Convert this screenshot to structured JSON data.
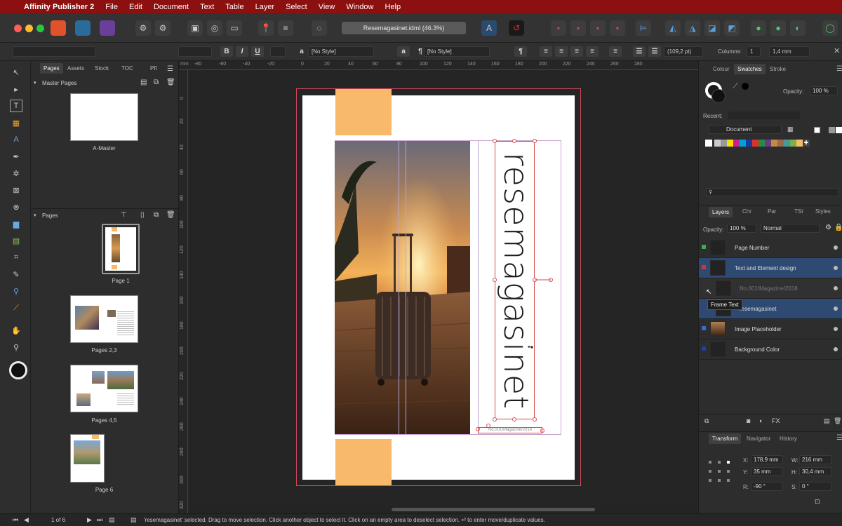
{
  "menubar": {
    "app_name": "Affinity Publisher 2",
    "items": [
      "File",
      "Edit",
      "Document",
      "Text",
      "Table",
      "Layer",
      "Select",
      "View",
      "Window",
      "Help"
    ]
  },
  "toolbar": {
    "document_title": "Resemagasinet.idml (46.3%)"
  },
  "context": {
    "style1": "[No Style]",
    "style2": "[No Style]",
    "bold": "B",
    "italic": "I",
    "underline": "U",
    "leading": "(109,2 pt)",
    "columns_label": "Columns:",
    "columns_value": "1",
    "gutter": "1,4 mm"
  },
  "left_panel": {
    "tabs": [
      "Pages",
      "Assets",
      "Stock",
      "TOC",
      "Pfl"
    ],
    "master_section": "Master Pages",
    "master_label": "A-Master",
    "pages_section": "Pages",
    "page_labels": [
      "Page 1",
      "Pages 2,3",
      "Pages 4,5",
      "Page 6"
    ]
  },
  "ruler": {
    "top_ticks": [
      "-80",
      "-60",
      "-40",
      "-20",
      "0",
      "20",
      "40",
      "60",
      "80",
      "100",
      "120",
      "140",
      "160",
      "180",
      "200",
      "220",
      "240",
      "260",
      "280"
    ],
    "left_ticks": [
      "0",
      "20",
      "40",
      "60",
      "80",
      "100",
      "120",
      "140",
      "160",
      "180",
      "200",
      "220",
      "240",
      "260",
      "280",
      "300",
      "320"
    ]
  },
  "canvas": {
    "vertical_title": "resemagasinet",
    "small_caption": "No.001/Magazine/2018"
  },
  "right_panel": {
    "color_tabs": [
      "Colour",
      "Swatches",
      "Stroke"
    ],
    "opacity_label": "Opacity:",
    "opacity_value": "100 %",
    "recent_label": "Recent:",
    "palette": "Document",
    "layer_tabs": [
      "Layers",
      "Chr",
      "Par",
      "TSt",
      "Styles"
    ],
    "layer_opacity_label": "Opacity:",
    "layer_opacity": "100 %",
    "blend_mode": "Normal",
    "layers": [
      {
        "name": "Page Number"
      },
      {
        "name": "Text and Element design"
      },
      {
        "name": "No.001/Magazine/2018"
      },
      {
        "name": "resemagasinet"
      },
      {
        "name": "Image Placeholder"
      },
      {
        "name": "Background Color"
      }
    ],
    "tooltip": "Frame Text",
    "transform_tabs": [
      "Transform",
      "Navigator",
      "History"
    ],
    "transform": {
      "x_label": "X:",
      "x": "178,9 mm",
      "w_label": "W:",
      "w": "216 mm",
      "y_label": "Y:",
      "y": "35 mm",
      "h_label": "H:",
      "h": "30,4 mm",
      "r_label": "R:",
      "r": "-90 °",
      "s_label": "S:",
      "s": "0 °"
    }
  },
  "status": {
    "page_counter": "1 of 6",
    "message": "'resemagasinet' selected. Drag to move selection. Click another object to select it. Click on an empty area to deselect selection. ⏎ to enter move/duplicate values."
  },
  "colors": {
    "menubar": "#8c1010",
    "accent_orange": "#f9b96a",
    "selection_red": "#e0393a",
    "layer_selected": "#2e4a73"
  }
}
